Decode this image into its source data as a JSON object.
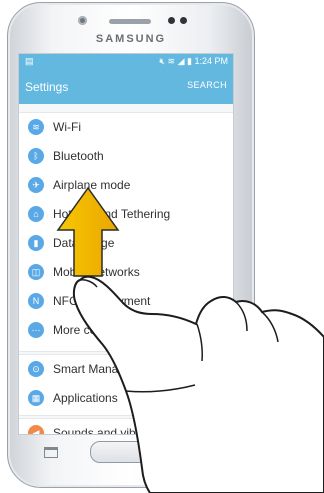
{
  "device": {
    "brand": "SAMSUNG"
  },
  "status_bar": {
    "time": "1:24 PM",
    "left_icon": "notification-icon",
    "right_icons": [
      "mute-icon",
      "wifi-icon",
      "signal-icon",
      "battery-icon"
    ]
  },
  "app_bar": {
    "title": "Settings",
    "search_label": "SEARCH",
    "color": "#63b8e0"
  },
  "settings": {
    "items": [
      {
        "label": "Wi-Fi",
        "icon": "wifi-icon",
        "color": "#5aa9e6"
      },
      {
        "label": "Bluetooth",
        "icon": "bluetooth-icon",
        "color": "#5aa9e6"
      },
      {
        "label": "Airplane mode",
        "icon": "airplane-icon",
        "color": "#5aa9e6"
      },
      {
        "label": "Hotspot and Tethering",
        "icon": "hotspot-icon",
        "color": "#5aa9e6"
      },
      {
        "label": "Data usage",
        "icon": "data-usage-icon",
        "color": "#5aa9e6"
      },
      {
        "label": "Mobile networks",
        "icon": "mobile-networks-icon",
        "color": "#5aa9e6"
      },
      {
        "label": "NFC and payment",
        "icon": "nfc-icon",
        "color": "#5aa9e6"
      },
      {
        "label": "More connection settings",
        "icon": "more-connections-icon",
        "color": "#5aa9e6"
      },
      {
        "label": "Smart Manager",
        "icon": "smart-manager-icon",
        "color": "#5aa9e6"
      },
      {
        "label": "Applications",
        "icon": "applications-icon",
        "color": "#5aa9e6"
      },
      {
        "label": "Sounds and vibration",
        "icon": "sound-icon",
        "color": "#f08a4b"
      }
    ]
  },
  "gesture": {
    "direction": "up",
    "arrow_color": "#f5b800",
    "icon": "swipe-up-arrow-icon"
  }
}
